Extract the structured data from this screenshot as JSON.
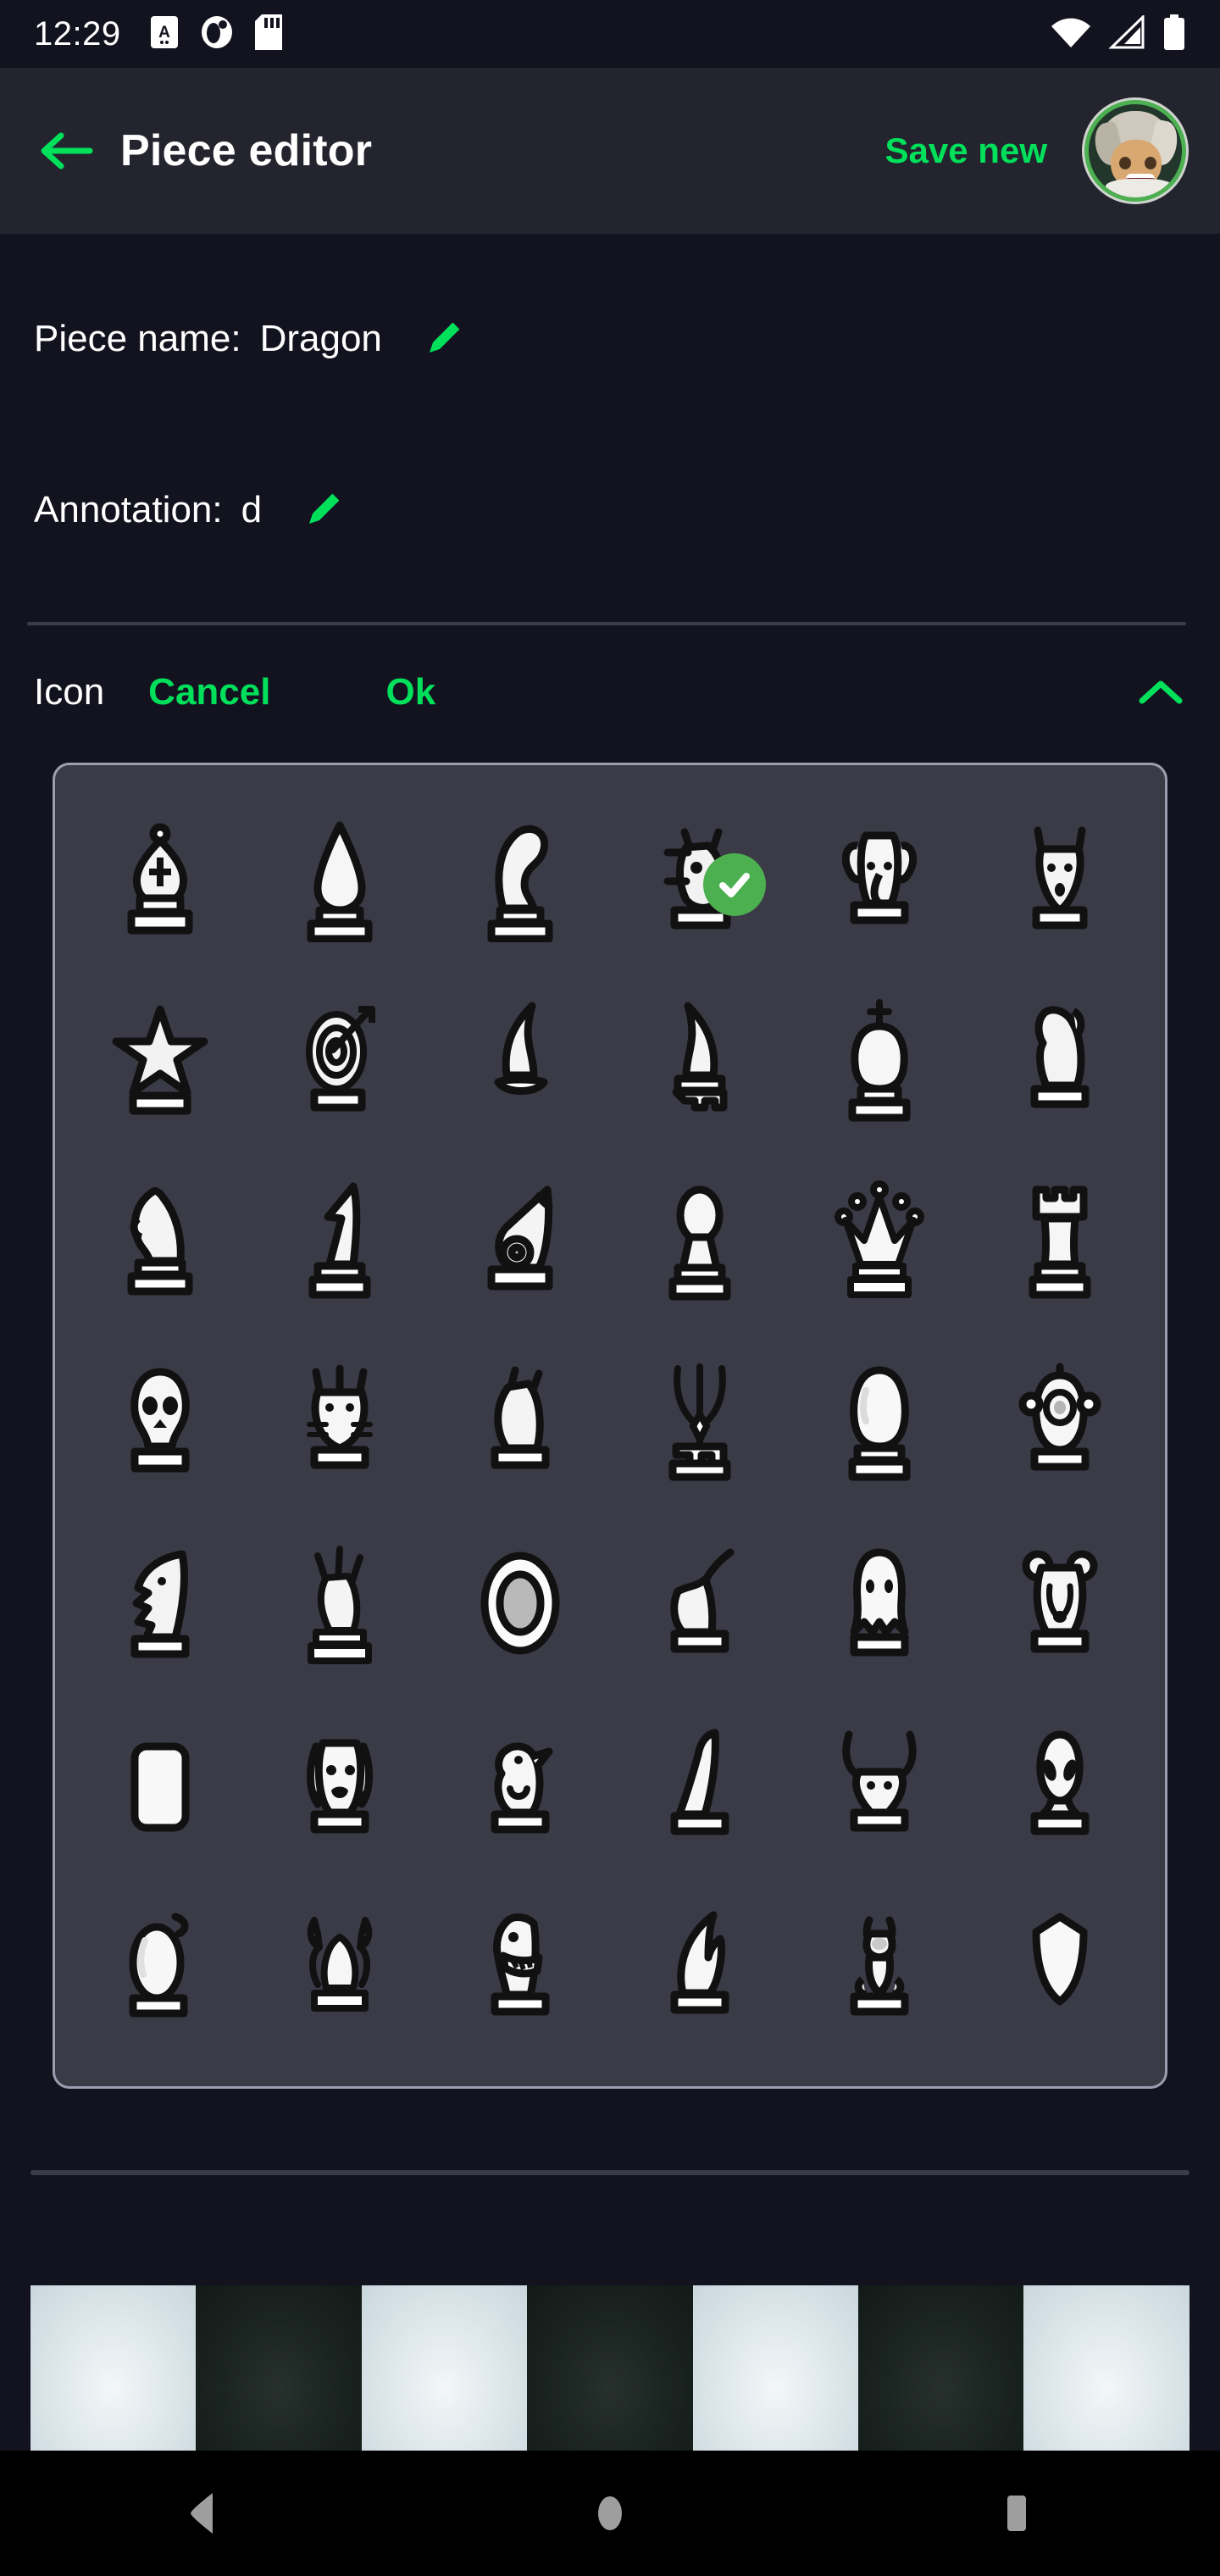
{
  "status_bar": {
    "time": "12:29",
    "left_icons": [
      "alphabet-notification-icon",
      "do-not-disturb-icon",
      "sd-card-icon"
    ],
    "right_icons": [
      "wifi-icon",
      "cellular-signal-icon",
      "battery-icon"
    ]
  },
  "app_bar": {
    "back_label": "back-arrow",
    "title": "Piece editor",
    "save_label": "Save new",
    "avatar_alt": "user-avatar",
    "accent_color": "#00e05a"
  },
  "fields": {
    "name_label": "Piece name:",
    "name_value": "Dragon",
    "name_edit_icon": "pencil-icon",
    "annotation_label": "Annotation:",
    "annotation_value": "d",
    "annotation_edit_icon": "pencil-icon"
  },
  "icon_section": {
    "label": "Icon",
    "cancel_label": "Cancel",
    "ok_label": "Ok",
    "collapse_icon": "chevron-up-icon",
    "selected_index": 3,
    "selected_check_color": "#4caf50",
    "icons": [
      {
        "name": "bishop-cross-icon"
      },
      {
        "name": "bishop-plain-icon"
      },
      {
        "name": "knight-mane-icon"
      },
      {
        "name": "dragon-icon"
      },
      {
        "name": "elephant-icon"
      },
      {
        "name": "wolf-head-icon"
      },
      {
        "name": "star-icon"
      },
      {
        "name": "target-arrow-icon"
      },
      {
        "name": "knight-left-icon"
      },
      {
        "name": "knight-right-icon"
      },
      {
        "name": "king-crown-icon"
      },
      {
        "name": "lion-icon"
      },
      {
        "name": "knight-classic-icon"
      },
      {
        "name": "knight-angular-icon"
      },
      {
        "name": "cannon-icon"
      },
      {
        "name": "pawn-icon"
      },
      {
        "name": "queen-icon"
      },
      {
        "name": "rook-icon"
      },
      {
        "name": "skull-icon"
      },
      {
        "name": "cat-icon"
      },
      {
        "name": "horse-head-icon"
      },
      {
        "name": "trident-icon"
      },
      {
        "name": "orb-icon"
      },
      {
        "name": "owl-icon"
      },
      {
        "name": "howling-wolf-icon"
      },
      {
        "name": "flame-statue-icon"
      },
      {
        "name": "disc-icon"
      },
      {
        "name": "hare-icon"
      },
      {
        "name": "ghost-icon"
      },
      {
        "name": "bear-icon"
      },
      {
        "name": "blank-square-icon"
      },
      {
        "name": "dog-icon"
      },
      {
        "name": "duck-icon"
      },
      {
        "name": "bird-icon"
      },
      {
        "name": "bull-icon"
      },
      {
        "name": "alien-icon"
      },
      {
        "name": "bomb-icon"
      },
      {
        "name": "crab-icon"
      },
      {
        "name": "dinosaur-icon"
      },
      {
        "name": "wing-icon"
      },
      {
        "name": "rose-icon"
      },
      {
        "name": "shield-icon"
      }
    ]
  },
  "board_preview": {
    "squares": [
      "light",
      "dark",
      "light",
      "dark",
      "light",
      "dark",
      "light"
    ],
    "light_color": "#dfe8ec",
    "dark_color": "#1b2420"
  },
  "nav_bar": {
    "back_icon": "triangle-back-icon",
    "home_icon": "circle-home-icon",
    "recents_icon": "square-recents-icon"
  }
}
